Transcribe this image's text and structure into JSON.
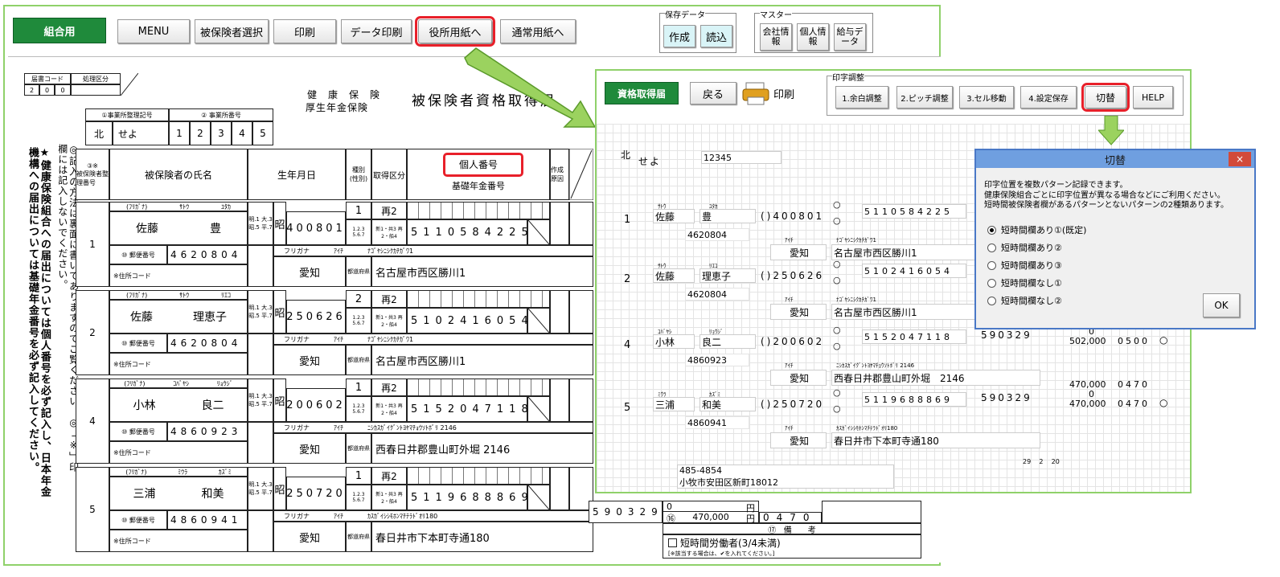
{
  "toolbar": {
    "kumiai": "組合用",
    "menu": "MENU",
    "select": "被保険者選択",
    "print": "印刷",
    "dataprint": "データ印刷",
    "yakusho": "役所用紙へ",
    "tsujo": "通常用紙へ",
    "save_group": "保存データ",
    "create": "作成",
    "load": "読込",
    "master_group": "マスター",
    "company": "会社情報",
    "personal": "個人情報",
    "salary": "給与データ"
  },
  "form": {
    "code_label": "届書コード",
    "proc_label": "処理区分",
    "code_digits": [
      "2",
      "0",
      "0"
    ],
    "title_top": "健　康　保　険",
    "title_bottom": "厚生年金保険",
    "title_main": "被保険者資格取得届",
    "office_code_label": "①事業所整理記号",
    "office_no_label": "② 事業所番号",
    "office_pref": "北",
    "office_sym": "せよ",
    "office_no": [
      "1",
      "2",
      "3",
      "4",
      "5"
    ],
    "vert_note_a": "★健康保険組合への届出については個人番号を必ず記入し、日本年金機構への届出については基礎年金番号を必ず記入してください。",
    "vert_note_b": "◎記入の方法は裏面に書いてありますのでご覧ください。◎「※」印欄には記入しないでください。",
    "col_no": "③※",
    "col_no_sub": "被保険者整理番号",
    "col_name": "被保険者の氏名",
    "col_birth": "生年月日",
    "col_kind": "種別",
    "col_kind_sub": "(性別)",
    "col_acq": "取得区分",
    "col_mynum": "個人番号",
    "col_basic": "基礎年金番号",
    "col_note": "作成原因",
    "furigana_label": "(ﾌﾘｶﾞﾅ)",
    "postal_label": "⑩ 郵便番号",
    "addr_code_label": "※住所コード",
    "pref_label": "都道府県",
    "furigana_addr": "フリガナ",
    "era_note": "明.1 大.3 昭.5 平.7",
    "kind_note": "1.2.3 5.6.7",
    "acq_note": "新1・共3 再2・船4",
    "rows": [
      {
        "no": "1",
        "kana_sei": "ｻﾄｳ",
        "kana_mei": "ﾕﾀｶ",
        "sei": "佐藤",
        "mei": "豊",
        "era": "昭",
        "birth": "400801",
        "kind": "1",
        "acq": "再2",
        "basic": "5110584225",
        "postal": "4620804",
        "pref_kana": "ｱｲﾁ",
        "addr_kana": "ﾅｺﾞﾔｼﾆｼｸｶﾁｶﾞﾜ1",
        "pref": "愛知",
        "addr": "名古屋市西区勝川1"
      },
      {
        "no": "2",
        "kana_sei": "ｻﾄｳ",
        "kana_mei": "ﾘｴｺ",
        "sei": "佐藤",
        "mei": "理恵子",
        "era": "昭",
        "birth": "250626",
        "kind": "2",
        "acq": "再2",
        "basic": "5102416054",
        "postal": "4620804",
        "pref_kana": "ｱｲﾁ",
        "addr_kana": "ﾅｺﾞﾔｼﾆｼｸｶﾁｶﾞﾜ1",
        "pref": "愛知",
        "addr": "名古屋市西区勝川1"
      },
      {
        "no": "4",
        "kana_sei": "ｺﾊﾞﾔｼ",
        "kana_mei": "ﾘｮｳｼﾞ",
        "sei": "小林",
        "mei": "良二",
        "era": "昭",
        "birth": "200602",
        "kind": "1",
        "acq": "再2",
        "basic": "5152047118",
        "postal": "4860923",
        "pref_kana": "ｱｲﾁ",
        "addr_kana": "ﾆｼｶｽｶﾞｲｸﾞﾝﾄﾖﾔﾏﾁｮｳｿﾄﾎﾞﾘ 2146",
        "pref": "愛知",
        "addr": "西春日井郡豊山町外堀 2146"
      },
      {
        "no": "5",
        "kana_sei": "ﾐｳﾗ",
        "kana_mei": "ｶｽﾞﾐ",
        "sei": "三浦",
        "mei": "和美",
        "era": "昭",
        "birth": "250720",
        "kind": "1",
        "acq": "再2",
        "basic": "5119688869",
        "postal": "4860941",
        "pref_kana": "ｱｲﾁ",
        "addr_kana": "ｶｽｶﾞｲｼｼﾓﾎﾝﾏﾁﾃﾗﾄﾞｵﾘ180",
        "pref": "愛知",
        "addr": "春日井市下本町寺通180"
      }
    ],
    "row5_extra": {
      "code": "590329",
      "amount": "470,000",
      "yen": "円",
      "extra": "0470",
      "zero": "0",
      "short_time": "短時間労働者(3/4未満)",
      "short_note": "[※該当する場合は、✔を入れてください。]",
      "remarks": "備　　考",
      "remarks_no": "⑰",
      "c_mark": "⑯"
    }
  },
  "preview": {
    "btn_main": "資格取得届",
    "back": "戻る",
    "print": "印刷",
    "adjust_group": "印字調整",
    "b1": "1.余白調整",
    "b2": "2.ピッチ調整",
    "b3": "3.セル移動",
    "b4": "4.設定保存",
    "switch": "切替",
    "help": "HELP",
    "pref": "北",
    "sym": "せよ",
    "no": "12345",
    "rows": [
      {
        "no": "1",
        "ks": "ｻﾄｳ",
        "km": "ﾕﾀｶ",
        "sei": "佐藤",
        "mei": "豊",
        "birth": "()400801",
        "basic": "5110584225",
        "postal": "4620804",
        "pk": "ｱｲﾁ",
        "ak": "ﾅｺﾞﾔｼﾆｼｸｶﾁｶﾞﾜ1",
        "pref": "愛知",
        "addr": "名古屋市西区勝川1"
      },
      {
        "no": "2",
        "ks": "ｻﾄｳ",
        "km": "ﾘｴｺ",
        "sei": "佐藤",
        "mei": "理恵子",
        "birth": "()250626",
        "basic": "5102416054",
        "postal": "4620804",
        "pk": "ｱｲﾁ",
        "ak": "ﾅｺﾞﾔｼﾆｼｸｶﾁｶﾞﾜ1",
        "pref": "愛知",
        "addr": "名古屋市西区勝川1"
      },
      {
        "no": "4",
        "ks": "ｺﾊﾞﾔｼ",
        "km": "ﾘｮｳｼﾞ",
        "sei": "小林",
        "mei": "良二",
        "birth": "()200602",
        "basic": "5152047118",
        "code": "590329",
        "amt1": "502,000",
        "amt0": "0",
        "amt2": "502,000",
        "ex1": "0500",
        "ex2": "0500",
        "postal": "4860923",
        "pk": "ｱｲﾁ",
        "ak": "ﾆｼｶｽｶﾞｲｸﾞﾝﾄﾖﾔﾏﾁｮｳｿﾄﾎﾞﾘ 2146",
        "pref": "愛知",
        "addr": "西春日井郡豊山町外堀　2146"
      },
      {
        "no": "5",
        "ks": "ﾐｳﾗ",
        "km": "ｶｽﾞﾐ",
        "sei": "三浦",
        "mei": "和美",
        "birth": "()250720",
        "basic": "5119688869",
        "code": "590329",
        "amt1": "470,000",
        "amt0": "0",
        "amt2": "470,000",
        "ex1": "0470",
        "ex2": "0470",
        "postal": "4860941",
        "pk": "ｱｲﾁ",
        "ak": "ｶｽｶﾞｲｼｼﾓﾎﾝﾏﾁﾃﾗﾄﾞｵﾘ180",
        "pref": "愛知",
        "addr": "春日井市下本町寺通180"
      }
    ],
    "date": [
      "29",
      "2",
      "20"
    ],
    "office_postal": "485-4854",
    "office_addr": "小牧市安田区新町18012"
  },
  "dialog": {
    "title": "切替",
    "desc1": "印字位置を複数パターン記録できます。",
    "desc2": "健康保険組合ごとに印字位置が異なる場合などにご利用ください。",
    "desc3": "短時間被保険者欄があるパターンとないパターンの2種類あります。",
    "options": [
      "短時間欄あり①(既定)",
      "短時間欄あり②",
      "短時間欄あり③",
      "短時間欄なし①",
      "短時間欄なし②"
    ],
    "ok": "OK",
    "close": "×"
  }
}
